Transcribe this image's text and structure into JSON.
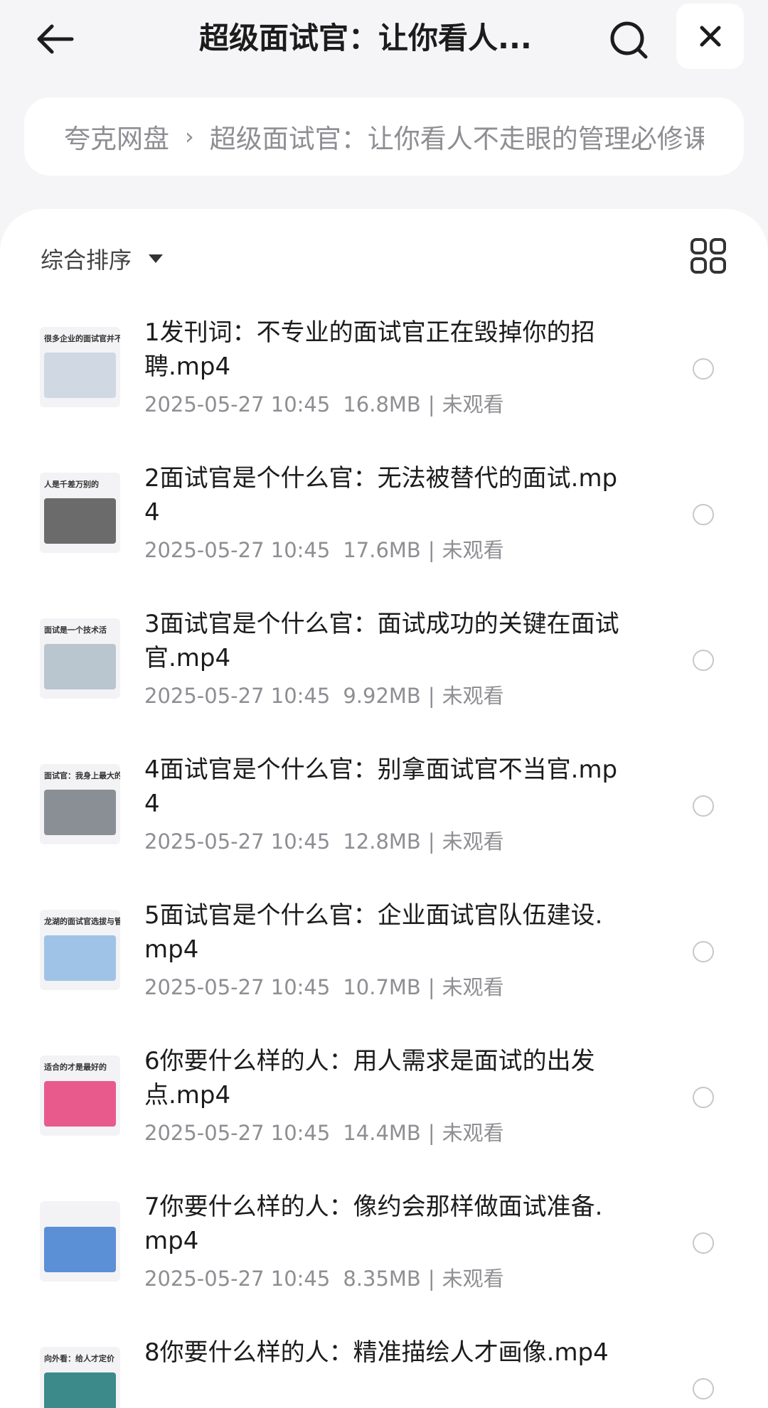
{
  "header": {
    "title": "超级面试官：让你看人...",
    "back_icon": "arrow-left-icon",
    "search_icon": "search-icon",
    "close_icon": "close-icon"
  },
  "breadcrumb": {
    "root": "夸克网盘",
    "separator": "›",
    "folder": "超级面试官：让你看人不走眼的管理必修课"
  },
  "toolbar": {
    "sort_label": "综合排序",
    "view_icon": "grid-view-icon"
  },
  "files": [
    {
      "name": "1发刊词：不专业的面试官正在毁掉你的招聘.mp4",
      "date": "2025-05-27 10:45",
      "size": "16.8MB",
      "status": "未观看",
      "thumb_caption": "很多企业的面试官并不专业",
      "thumb_color": "#cfd8e3"
    },
    {
      "name": "2面试官是个什么官：无法被替代的面试.mp4",
      "date": "2025-05-27 10:45",
      "size": "17.6MB",
      "status": "未观看",
      "thumb_caption": "人是千差万别的",
      "thumb_color": "#6b6b6b"
    },
    {
      "name": "3面试官是个什么官：面试成功的关键在面试官.mp4",
      "date": "2025-05-27 10:45",
      "size": "9.92MB",
      "status": "未观看",
      "thumb_caption": "面试是一个技术活",
      "thumb_color": "#b9c6cf"
    },
    {
      "name": "4面试官是个什么官：别拿面试官不当官.mp4",
      "date": "2025-05-27 10:45",
      "size": "12.8MB",
      "status": "未观看",
      "thumb_caption": "面试官：我身上最大的是什么?",
      "thumb_color": "#8a8f96"
    },
    {
      "name": "5面试官是个什么官：企业面试官队伍建设.mp4",
      "date": "2025-05-27 10:45",
      "size": "10.7MB",
      "status": "未观看",
      "thumb_caption": "龙湖的面试官选拔与管理",
      "thumb_color": "#9fc3e6"
    },
    {
      "name": "6你要什么样的人：用人需求是面试的出发点.mp4",
      "date": "2025-05-27 10:45",
      "size": "14.4MB",
      "status": "未观看",
      "thumb_caption": "适合的才是最好的",
      "thumb_color": "#e85a8c"
    },
    {
      "name": "7你要什么样的人：像约会那样做面试准备.mp4",
      "date": "2025-05-27 10:45",
      "size": "8.35MB",
      "status": "未观看",
      "thumb_caption": "",
      "thumb_color": "#5b8fd6"
    },
    {
      "name": "8你要什么样的人：精准描绘人才画像.mp4",
      "date": "",
      "size": "",
      "status": "",
      "thumb_caption": "向外看：给人才定价",
      "thumb_color": "#3d8a8a"
    }
  ]
}
